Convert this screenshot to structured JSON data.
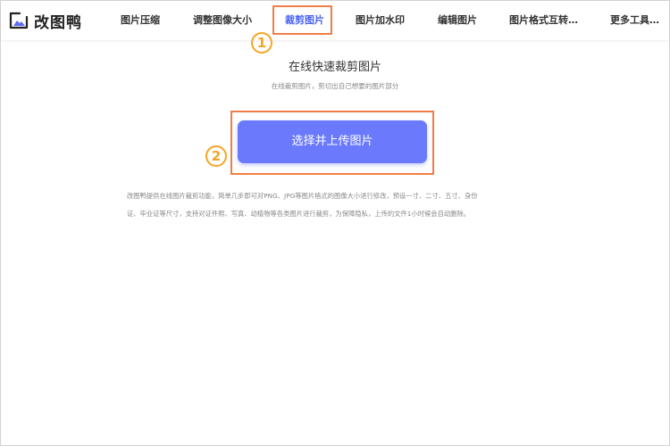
{
  "app": {
    "name": "改图鸭"
  },
  "nav": {
    "items": [
      {
        "label": "图片压缩"
      },
      {
        "label": "调整图像大小"
      },
      {
        "label": "裁剪图片"
      },
      {
        "label": "图片加水印"
      },
      {
        "label": "编辑图片"
      },
      {
        "label": "图片格式互转…"
      },
      {
        "label": "更多工具…"
      }
    ],
    "active_index": 2
  },
  "markers": {
    "step1": "1",
    "step2": "2"
  },
  "main": {
    "title": "在线快速裁剪图片",
    "subtitle": "在线裁剪图片，剪切出自己想要的图片部分",
    "upload_button": "选择并上传图片",
    "description_line1": "改图鸭提供在线图片裁剪功能，简单几步即可对PNG、JPG等图片格式的图像大小进行修改，预设一寸、二寸、五寸、身份",
    "description_line2": "证、毕业证等尺寸，支持对证件照、写真、动植物等各类图片进行裁剪，为保障隐私，上传的文件1小时候会自动删除。"
  },
  "colors": {
    "accent": "#4a62f5",
    "button": "#6b7afc",
    "highlight": "#f07d48",
    "marker": "#f5a524"
  }
}
